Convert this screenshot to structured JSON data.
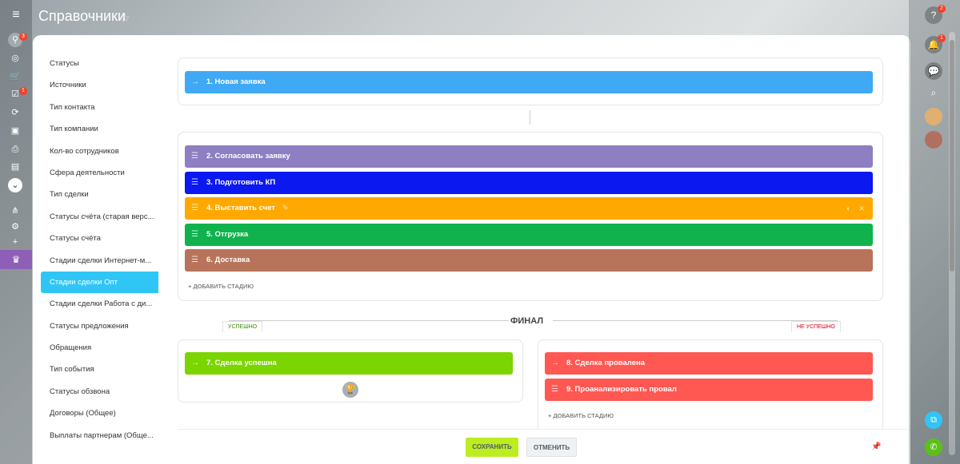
{
  "header": {
    "title": "Справочники"
  },
  "leftbar": {
    "badges": {
      "filter": "3",
      "tasks": "1"
    }
  },
  "rightbar": {
    "badges": {
      "help": "2",
      "notifications": "1"
    }
  },
  "sidebar": {
    "items": [
      {
        "label": "Статусы"
      },
      {
        "label": "Источники"
      },
      {
        "label": "Тип контакта"
      },
      {
        "label": "Тип компании"
      },
      {
        "label": "Кол-во сотрудников"
      },
      {
        "label": "Сфера деятельности"
      },
      {
        "label": "Тип сделки"
      },
      {
        "label": "Статусы счёта (старая верс..."
      },
      {
        "label": "Статусы счёта"
      },
      {
        "label": "Стадии сделки Интернет-м..."
      },
      {
        "label": "Стадии сделки Опт"
      },
      {
        "label": "Стадии сделки Работа с ди..."
      },
      {
        "label": "Статусы предложения"
      },
      {
        "label": "Обращения"
      },
      {
        "label": "Тип события"
      },
      {
        "label": "Статусы обзвона"
      },
      {
        "label": "Договоры (Общее)"
      },
      {
        "label": "Выплаты партнерам (Обще..."
      }
    ],
    "active_index": 10
  },
  "stages": {
    "initial": {
      "label": "1. Новая заявка",
      "color": "#3fa9f5"
    },
    "process": [
      {
        "label": "2. Согласовать заявку",
        "color": "#8d7fc2"
      },
      {
        "label": "3. Подготовить КП",
        "color": "#0b18f0"
      },
      {
        "label": "4. Выставить счет",
        "color": "#ffa900"
      },
      {
        "label": "5. Отгрузка",
        "color": "#0fb24c"
      },
      {
        "label": "6. Доставка",
        "color": "#b7745a"
      }
    ],
    "add_stage": "+ ДОБАВИТЬ СТАДИЮ",
    "final": {
      "title": "ФИНАЛ",
      "success_tab": "УСПЕШНО",
      "fail_tab": "НЕ УСПЕШНО",
      "success": {
        "label": "7. Сделка успешна",
        "color": "#7bd500"
      },
      "fail": [
        {
          "label": "8. Сделка провалена",
          "color": "#ff5752"
        },
        {
          "label": "9. Проанализировать провал",
          "color": "#ff5752"
        }
      ],
      "add_stage": "+ ДОБАВИТЬ СТАДИЮ"
    }
  },
  "footer": {
    "save": "СОХРАНИТЬ",
    "cancel": "ОТМЕНИТЬ"
  }
}
